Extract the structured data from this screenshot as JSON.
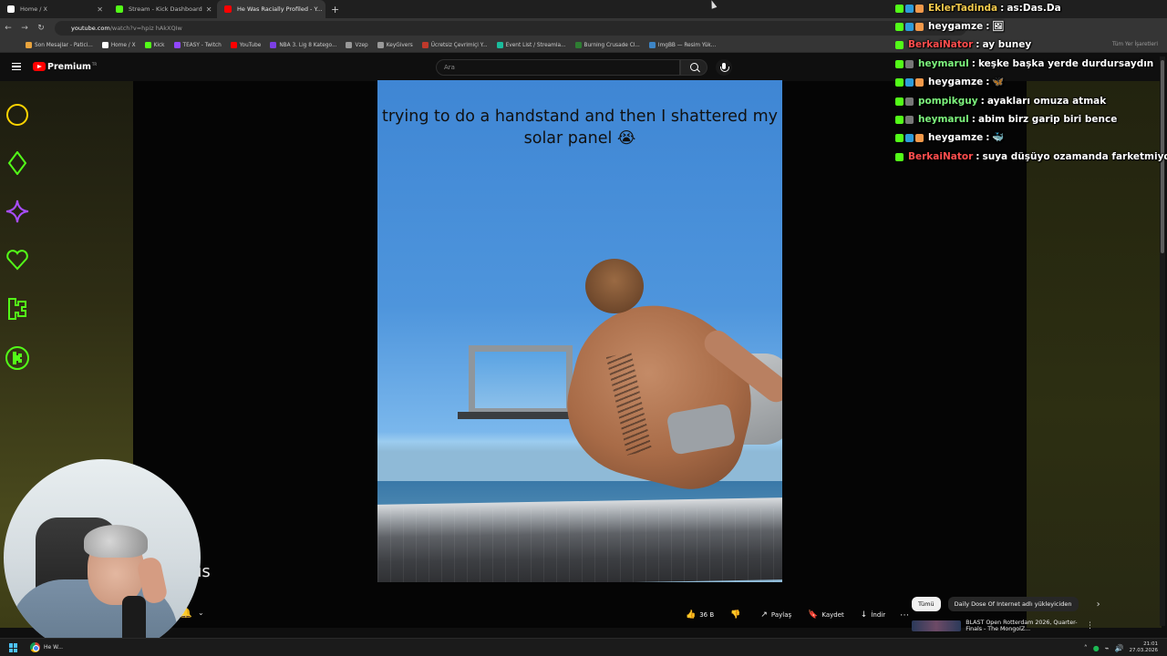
{
  "browser": {
    "tabs": [
      {
        "title": "Home / X",
        "icon": "x-logo-icon",
        "color": "#ffffff",
        "active": false
      },
      {
        "title": "Stream - Kick Dashboard",
        "icon": "kick-logo-icon",
        "color": "#53fc18",
        "active": false
      },
      {
        "title": "He Was Racially Profiled - Y...",
        "icon": "youtube-logo-icon",
        "color": "#ff0000",
        "active": true
      }
    ],
    "url_host": "youtube.com",
    "url_path": "/watch?v=hpiz hAkXQIw",
    "bookmarks": [
      {
        "label": "Son Mesajlar - Patici...",
        "color": "#e8a33d"
      },
      {
        "label": "Home / X",
        "color": "#ffffff"
      },
      {
        "label": "Kick",
        "color": "#53fc18"
      },
      {
        "label": "TEASY - Twitch",
        "color": "#9146ff"
      },
      {
        "label": "YouTube",
        "color": "#ff0000"
      },
      {
        "label": "NBA 3. Lig 8 Katego...",
        "color": "#7b3fe4"
      },
      {
        "label": "Vzep",
        "color": "#999999"
      },
      {
        "label": "KeyGivers",
        "color": "#999999"
      },
      {
        "label": "Ücretsiz Çevrimiçi Y...",
        "color": "#c0392b"
      },
      {
        "label": "Event List / Streamla...",
        "color": "#1abc9c"
      },
      {
        "label": "Burning Crusade Cl...",
        "color": "#2e7d32"
      },
      {
        "label": "ImgBB — Resim Yük...",
        "color": "#3d85c6"
      }
    ],
    "bookmarks_right": "Tüm Yer İşaretleri"
  },
  "youtube": {
    "brand": "Premium",
    "brand_sup": "TR",
    "search_placeholder": "Ara",
    "video_caption": "trying to do a handstand and then I shattered my solar panel 😭",
    "subtitle_fragment": "us",
    "actions": [
      {
        "icon": "like-icon",
        "glyph": "👍",
        "label": "36 B"
      },
      {
        "icon": "dislike-icon",
        "glyph": "👎",
        "label": ""
      },
      {
        "icon": "share-icon",
        "glyph": "↗",
        "label": "Paylaş"
      },
      {
        "icon": "save-icon",
        "glyph": "🔖",
        "label": "Kaydet"
      },
      {
        "icon": "download-icon",
        "glyph": "↓",
        "label": "İndir"
      }
    ],
    "chips": [
      "Tümü",
      "Daily Dose Of Internet adlı yükleyiciden"
    ],
    "recommended_title": "BLAST Open Rotterdam 2026, Quarter-Finals - The MongolZ..."
  },
  "chat": [
    {
      "user": "EklerTadinda",
      "user_color": "#f2c94c",
      "text": "as:Das.Da"
    },
    {
      "user": "heygamze",
      "user_color": "#ffffff",
      "text": "🖼"
    },
    {
      "user": "BerkaiNator",
      "user_color": "#ff4d4d",
      "text": "ay buney"
    },
    {
      "user": "heymarul",
      "user_color": "#7cf27c",
      "text": "keşke başka yerde durdursaydın"
    },
    {
      "user": "heygamze",
      "user_color": "#ffffff",
      "text": "🦋"
    },
    {
      "user": "pompikguy",
      "user_color": "#7cf27c",
      "text": "ayakları omuza atmak"
    },
    {
      "user": "heymarul",
      "user_color": "#7cf27c",
      "text": "abim birz garip biri bence"
    },
    {
      "user": "heygamze",
      "user_color": "#ffffff",
      "text": "🐳"
    },
    {
      "user": "BerkaiNator",
      "user_color": "#ff4d4d",
      "text": "suya düşüyo ozamanda farketmiyolar wth"
    }
  ],
  "overlay_icons": [
    {
      "name": "circle-icon",
      "color": "#ffd400"
    },
    {
      "name": "diamond-icon",
      "color": "#53fc18"
    },
    {
      "name": "sparkle-icon",
      "color": "#a84dff"
    },
    {
      "name": "heart-icon",
      "color": "#53fc18"
    },
    {
      "name": "kick-k-icon",
      "color": "#53fc18"
    },
    {
      "name": "kick-circle-icon",
      "color": "#53fc18"
    }
  ],
  "taskbar": {
    "app_label": "He W...",
    "time": "21:01",
    "date": "27.03.2026"
  }
}
